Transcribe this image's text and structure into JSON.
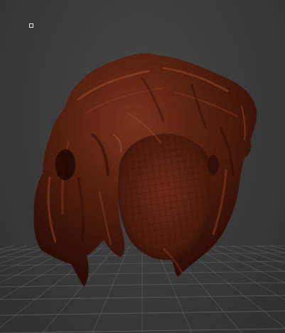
{
  "viewport": {
    "background": "#3a3a3a",
    "grid_color": "#6a6a6a",
    "model_color": "#4a1a0e",
    "model_highlight": "#8a3a24",
    "model_shadow": "#230806",
    "inner_color": "#5c2313",
    "marker_color": "#e8e8e8"
  },
  "model": {
    "icon": "hair-mesh",
    "shading": "wireframe-on-shaded"
  }
}
